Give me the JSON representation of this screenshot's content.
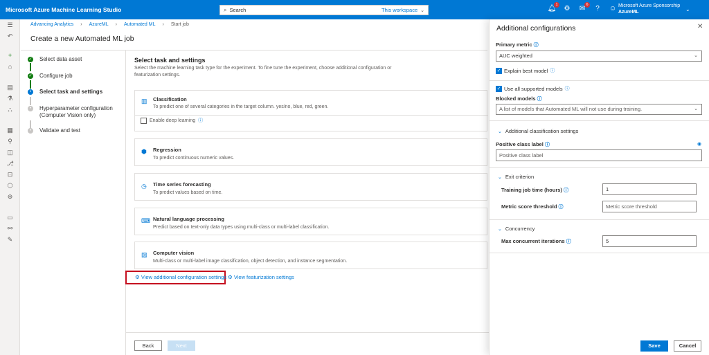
{
  "app": {
    "title": "Microsoft Azure Machine Learning Studio"
  },
  "search": {
    "placeholder": "Search",
    "scope": "This workspace"
  },
  "notifications": {
    "bell_count": "1",
    "feedback_count": "6"
  },
  "account": {
    "name": "Microsoft Azure Sponsorship",
    "workspace": "AzureML"
  },
  "breadcrumb": [
    "Advancing Analytics",
    "AzureML",
    "Automated ML",
    "Start job"
  ],
  "page_title": "Create a new Automated ML job",
  "steps": [
    {
      "label": "Select data asset",
      "status": "done"
    },
    {
      "label": "Configure job",
      "status": "done"
    },
    {
      "label": "Select task and settings",
      "status": "active"
    },
    {
      "label": "Hyperparameter configuration",
      "label2": "(Computer Vision only)",
      "status": "pending"
    },
    {
      "label": "Validate and test",
      "status": "pending"
    }
  ],
  "task": {
    "title": "Select task and settings",
    "description": "Select the machine learning task type for the experiment. To fine tune the experiment, choose additional configuration or featurization settings.",
    "cards": [
      {
        "icon": "bar-chart-icon",
        "title": "Classification",
        "desc": "To predict one of several categories in the target column. yes/no, blue, red, green."
      },
      {
        "icon": "regression-icon",
        "title": "Regression",
        "desc": "To predict continuous numeric values."
      },
      {
        "icon": "clock-icon",
        "title": "Time series forecasting",
        "desc": "To predict values based on time."
      },
      {
        "icon": "nlp-icon",
        "title": "Natural language processing",
        "desc": "Predict based on text-only data types using multi-class or multi-label classification."
      },
      {
        "icon": "image-icon",
        "title": "Computer vision",
        "desc": "Multi-class or multi-label image classification, object detection, and instance segmentation."
      }
    ],
    "deep_learning_label": "Enable deep learning",
    "link_additional": "View additional configuration settings",
    "link_featurization": "View featurization settings"
  },
  "footer": {
    "back": "Back",
    "next": "Next"
  },
  "panel": {
    "title": "Additional configurations",
    "primary_metric_label": "Primary metric",
    "primary_metric_value": "AUC weighted",
    "explain_best_model": "Explain best model",
    "use_all_models": "Use all supported models",
    "blocked_models_label": "Blocked models",
    "blocked_models_placeholder": "A list of models that Automated ML will not use during training.",
    "classification_section": "Additional classification settings",
    "positive_class_label": "Positive class label",
    "positive_class_placeholder": "Positive class label",
    "exit_section": "Exit criterion",
    "training_time_label": "Training job time (hours)",
    "training_time_value": "1",
    "metric_threshold_label": "Metric score threshold",
    "metric_threshold_placeholder": "Metric score threshold",
    "concurrency_section": "Concurrency",
    "max_concurrent_label": "Max concurrent iterations",
    "max_concurrent_value": "5",
    "save": "Save",
    "cancel": "Cancel"
  },
  "colors": {
    "brand": "#0078d4",
    "success": "#107c10",
    "highlight": "#c50f1f"
  }
}
